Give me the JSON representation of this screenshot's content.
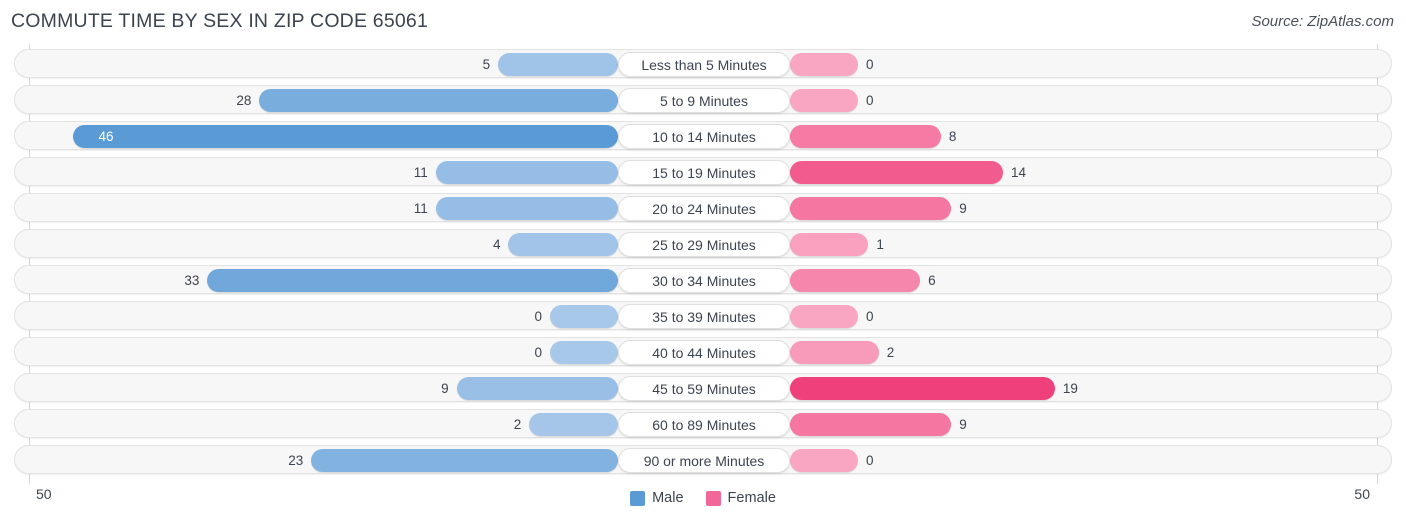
{
  "header": {
    "title": "COMMUTE TIME BY SEX IN ZIP CODE 65061",
    "source": "Source: ZipAtlas.com"
  },
  "axis": {
    "left_max_label": "50",
    "right_max_label": "50"
  },
  "legend": {
    "items": [
      {
        "label": "Male",
        "color": "#5b9bd5"
      },
      {
        "label": "Female",
        "color": "#f2669a"
      }
    ]
  },
  "colors": {
    "male_light": "#a8c8ea",
    "male_dark": "#5b9bd5",
    "female_light": "#f9a6c2",
    "female_dark": "#f0407c",
    "track_bg": "#f7f7f7",
    "track_border": "#e3e3e3",
    "text": "#3d4450"
  },
  "chart_data": {
    "type": "bar",
    "title": "Commute Time by Sex in Zip Code 65061",
    "subtitle": "Source: ZipAtlas.com",
    "orientation": "horizontal-diverging",
    "xlabel": "",
    "ylabel": "",
    "xlim": [
      50,
      50
    ],
    "axis_max": 50,
    "grid": true,
    "legend_position": "bottom-center",
    "categories": [
      "Less than 5 Minutes",
      "5 to 9 Minutes",
      "10 to 14 Minutes",
      "15 to 19 Minutes",
      "20 to 24 Minutes",
      "25 to 29 Minutes",
      "30 to 34 Minutes",
      "35 to 39 Minutes",
      "40 to 44 Minutes",
      "45 to 59 Minutes",
      "60 to 89 Minutes",
      "90 or more Minutes"
    ],
    "series": [
      {
        "name": "Male",
        "side": "left",
        "values": [
          5,
          28,
          46,
          11,
          11,
          4,
          33,
          0,
          0,
          9,
          2,
          23
        ],
        "labels": [
          "5",
          "28",
          "46",
          "11",
          "11",
          "4",
          "33",
          "0",
          "0",
          "9",
          "2",
          "23"
        ]
      },
      {
        "name": "Female",
        "side": "right",
        "values": [
          0,
          0,
          8,
          14,
          9,
          1,
          6,
          0,
          2,
          19,
          9,
          0
        ],
        "labels": [
          "0",
          "0",
          "8",
          "14",
          "9",
          "1",
          "6",
          "0",
          "2",
          "19",
          "9",
          "0"
        ]
      }
    ]
  }
}
